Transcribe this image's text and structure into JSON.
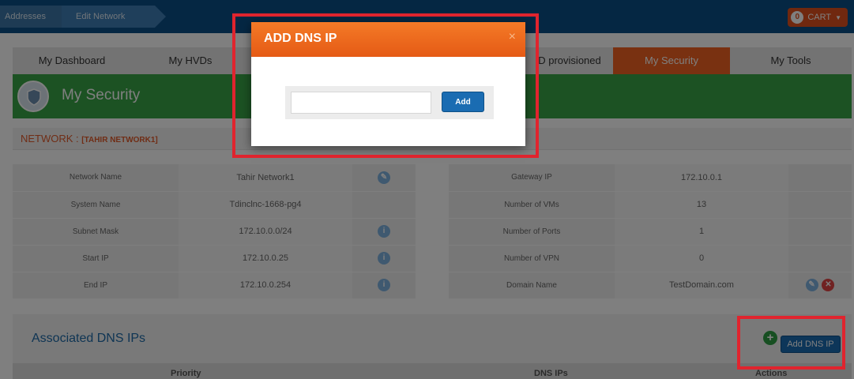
{
  "breadcrumb": [
    "Addresses",
    "Edit Network"
  ],
  "cart": {
    "count": "0",
    "label": "CART"
  },
  "tabs": [
    "My Dashboard",
    "My HVDs",
    "",
    "",
    "D provisioned",
    "My Security",
    "My Tools"
  ],
  "active_tab": "My Security",
  "colors": {
    "accent_orange": "#f26322",
    "header_green": "#39a547",
    "primary_blue": "#1a6cb2",
    "highlight_red": "#e0242e"
  },
  "security": {
    "title": "My Security",
    "icon": "shield-icon"
  },
  "network": {
    "label": "NETWORK :",
    "name": "[TAHIR NETWORK1]"
  },
  "left_table": [
    {
      "label": "Network Name",
      "value": "Tahir Network1",
      "icon": "edit-icon"
    },
    {
      "label": "System Name",
      "value": "Tdinclnc-1668-pg4",
      "icon": ""
    },
    {
      "label": "Subnet Mask",
      "value": "172.10.0.0/24",
      "icon": "info-icon"
    },
    {
      "label": "Start IP",
      "value": "172.10.0.25",
      "icon": "info-icon"
    },
    {
      "label": "End IP",
      "value": "172.10.0.254",
      "icon": "info-icon"
    }
  ],
  "right_table": [
    {
      "label": "Gateway IP",
      "value": "172.10.0.1"
    },
    {
      "label": "Number of VMs",
      "value": "13"
    },
    {
      "label": "Number of Ports",
      "value": "1"
    },
    {
      "label": "Number of VPN",
      "value": "0"
    },
    {
      "label": "Domain Name",
      "value": "TestDomain.com"
    }
  ],
  "dns": {
    "title": "Associated DNS IPs",
    "add_button": "Add DNS IP",
    "columns": [
      "Priority",
      "DNS IPs",
      "Actions"
    ]
  },
  "modal": {
    "title": "ADD DNS IP",
    "close": "×",
    "input_value": "",
    "add_button": "Add"
  }
}
